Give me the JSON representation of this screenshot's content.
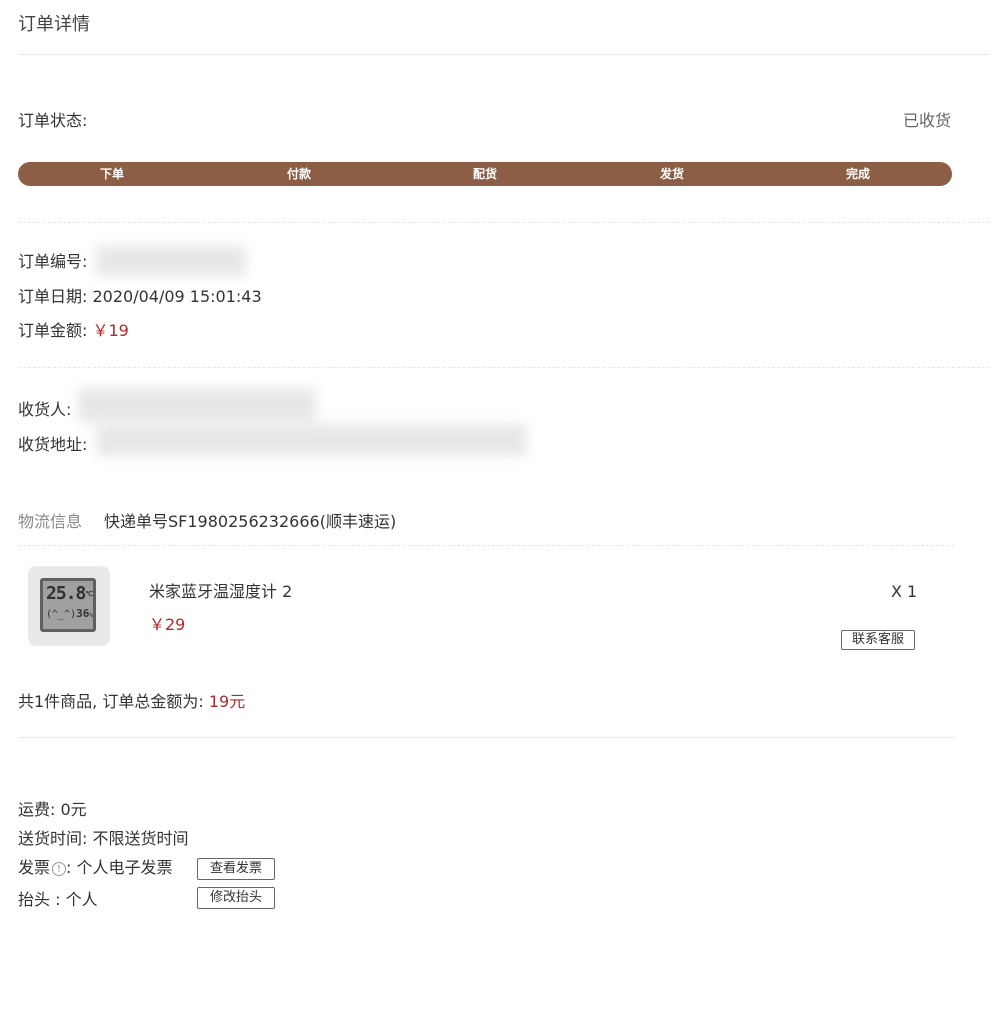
{
  "header": {
    "title": "订单详情"
  },
  "status": {
    "label": "订单状态:",
    "value": "已收货"
  },
  "progress": {
    "steps": [
      "下单",
      "付款",
      "配货",
      "发货",
      "完成"
    ],
    "bar_color": "#8b5e45"
  },
  "order": {
    "number_label": "订单编号:",
    "date_label": "订单日期:",
    "date_value": "2020/04/09 15:01:43",
    "amount_label": "订单金额:",
    "amount_value": "￥19"
  },
  "recipient": {
    "name_label": "收货人:",
    "address_label": "收货地址:"
  },
  "logistics": {
    "label": "物流信息",
    "value": "快递单号SF1980256232666(顺丰速运)"
  },
  "product": {
    "name": "米家蓝牙温湿度计 2",
    "price": "￥29",
    "quantity": "X 1",
    "service_button": "联系客服",
    "thumb_temp": "25.8",
    "thumb_unit_temp": "℃",
    "thumb_face": "(^_^)",
    "thumb_humidity": "36",
    "thumb_unit_humidity": "%"
  },
  "summary": {
    "text": "共1件商品, 订单总金额为:",
    "total": "19元"
  },
  "extra": {
    "shipping_fee": "运费: 0元",
    "delivery_time": "送货时间: 不限送货时间",
    "invoice_label": "发票",
    "invoice_icon": "!",
    "invoice_value": ": 个人电子发票",
    "view_invoice_button": "查看发票",
    "header_label": "抬头 : 个人",
    "edit_header_button": "修改抬头"
  },
  "colors": {
    "accent": "#8b5e45",
    "price_red": "#b0282e"
  }
}
